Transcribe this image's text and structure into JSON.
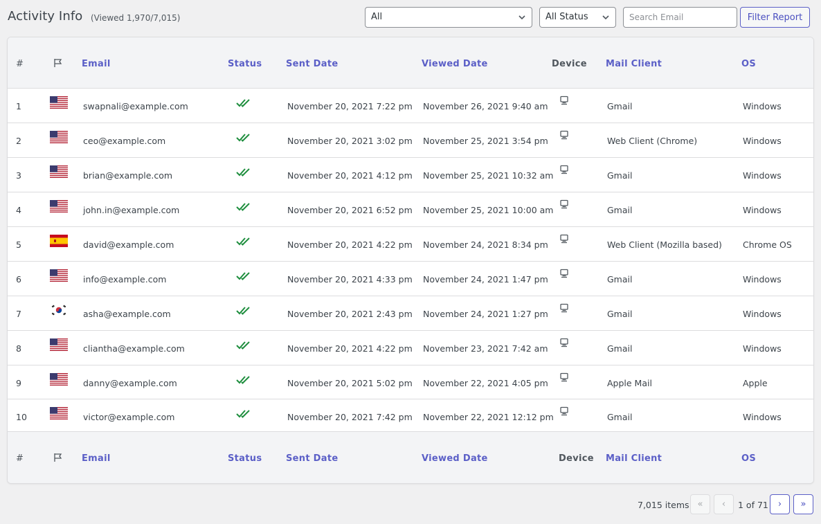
{
  "header": {
    "title": "Activity Info",
    "subtitle": "(Viewed 1,970/7,015)"
  },
  "filters": {
    "list_value": "All",
    "status_value": "All Status",
    "search_placeholder": "Search Email",
    "filter_button": "Filter Report"
  },
  "columns": {
    "num": "#",
    "email": "Email",
    "status": "Status",
    "sent": "Sent Date",
    "viewed": "Viewed Date",
    "device": "Device",
    "client": "Mail Client",
    "os": "OS"
  },
  "rows": [
    {
      "num": "1",
      "flag": "us-flag-icon",
      "email": "swapnali@example.com",
      "sent": "November 20, 2021 7:22 pm",
      "viewed": "November 26, 2021 9:40 am",
      "client": "Gmail",
      "os": "Windows"
    },
    {
      "num": "2",
      "flag": "us-flag-icon",
      "email": "ceo@example.com",
      "sent": "November 20, 2021 3:02 pm",
      "viewed": "November 25, 2021 3:54 pm",
      "client": "Web Client (Chrome)",
      "os": "Windows"
    },
    {
      "num": "3",
      "flag": "us-flag-icon",
      "email": "brian@example.com",
      "sent": "November 20, 2021 4:12 pm",
      "viewed": "November 25, 2021 10:32 am",
      "client": "Gmail",
      "os": "Windows"
    },
    {
      "num": "4",
      "flag": "us-flag-icon",
      "email": "john.in@example.com",
      "sent": "November 20, 2021 6:52 pm",
      "viewed": "November 25, 2021 10:00 am",
      "client": "Gmail",
      "os": "Windows"
    },
    {
      "num": "5",
      "flag": "es-flag-icon",
      "email": "david@example.com",
      "sent": "November 20, 2021 4:22 pm",
      "viewed": "November 24, 2021 8:34 pm",
      "client": "Web Client (Mozilla based)",
      "os": "Chrome OS"
    },
    {
      "num": "6",
      "flag": "us-flag-icon",
      "email": "info@example.com",
      "sent": "November 20, 2021 4:33 pm",
      "viewed": "November 24, 2021 1:47 pm",
      "client": "Gmail",
      "os": "Windows"
    },
    {
      "num": "7",
      "flag": "kr-flag-icon",
      "email": "asha@example.com",
      "sent": "November 20, 2021 2:43 pm",
      "viewed": "November 24, 2021 1:27 pm",
      "client": "Gmail",
      "os": "Windows"
    },
    {
      "num": "8",
      "flag": "us-flag-icon",
      "email": "cliantha@example.com",
      "sent": "November 20, 2021 4:22 pm",
      "viewed": "November 23, 2021 7:42 am",
      "client": "Gmail",
      "os": "Windows"
    },
    {
      "num": "9",
      "flag": "us-flag-icon",
      "email": "danny@example.com",
      "sent": "November 20, 2021 5:02 pm",
      "viewed": "November 22, 2021 4:05 pm",
      "client": "Apple Mail",
      "os": "Apple"
    },
    {
      "num": "10",
      "flag": "us-flag-icon",
      "email": "victor@example.com",
      "sent": "November 20, 2021 7:42 pm",
      "viewed": "November 22, 2021 12:12 pm",
      "client": "Gmail",
      "os": "Windows"
    }
  ],
  "pagination": {
    "items": "7,015 items",
    "first": "«",
    "prev": "‹",
    "page_label": "1 of 71",
    "next": "›",
    "last": "»"
  },
  "colors": {
    "accent": "#5b5fc7",
    "check": "#1e8e3e"
  }
}
